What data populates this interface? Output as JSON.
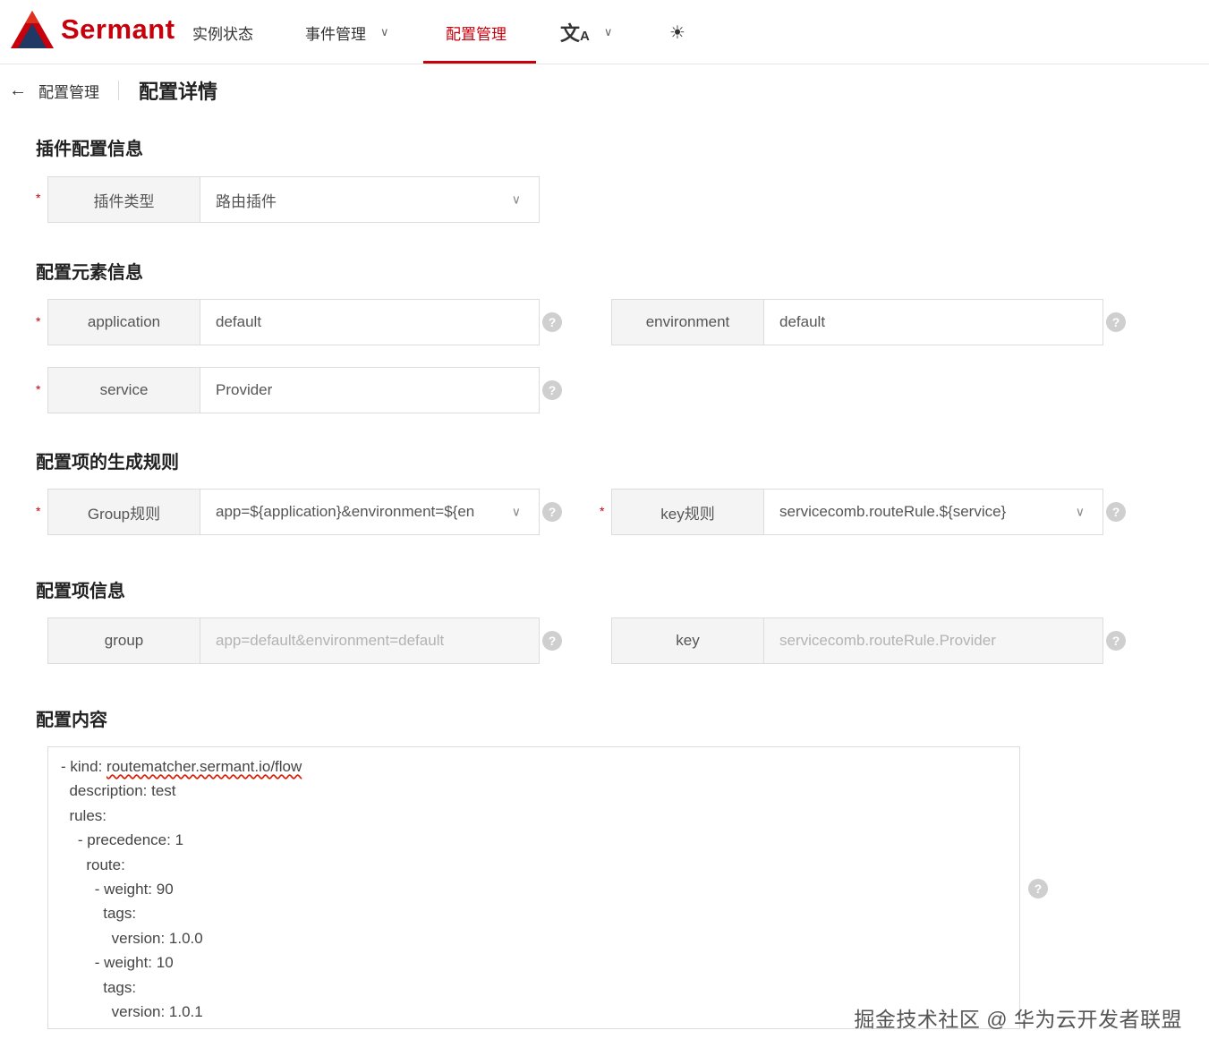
{
  "brand": {
    "name": "Sermant",
    "logo_icon": "sermant-logo-icon",
    "accent": "#c7000b"
  },
  "nav": {
    "instance_status": "实例状态",
    "event_management": "事件管理",
    "config_management": "配置管理"
  },
  "breadcrumb": {
    "parent": "配置管理",
    "current": "配置详情"
  },
  "sections": {
    "plugin_config": "插件配置信息",
    "config_elements": "配置元素信息",
    "generation_rules": "配置项的生成规则",
    "config_item_info": "配置项信息",
    "config_content": "配置内容"
  },
  "fields": {
    "plugin_type": {
      "label": "插件类型",
      "value": "路由插件"
    },
    "application": {
      "label": "application",
      "value": "default"
    },
    "environment": {
      "label": "environment",
      "value": "default"
    },
    "service": {
      "label": "service",
      "value": "Provider"
    },
    "group_rule": {
      "label": "Group规则",
      "value": "app=${application}&environment=${en"
    },
    "key_rule": {
      "label": "key规则",
      "value": "servicecomb.routeRule.${service}"
    },
    "group": {
      "label": "group",
      "value": "app=default&environment=default"
    },
    "key": {
      "label": "key",
      "value": "servicecomb.routeRule.Provider"
    }
  },
  "required_mark": "*",
  "help_glyph": "?",
  "config_content": {
    "lines": [
      {
        "prefix": "- kind: ",
        "underlined": "routematcher.sermant.io/flow"
      },
      {
        "prefix": "  description: test"
      },
      {
        "prefix": "  rules:"
      },
      {
        "prefix": "    - precedence: 1"
      },
      {
        "prefix": "      route:"
      },
      {
        "prefix": "        - weight: 90"
      },
      {
        "prefix": "          tags:"
      },
      {
        "prefix": "            version: 1.0.0"
      },
      {
        "prefix": "        - weight: 10"
      },
      {
        "prefix": "          tags:"
      },
      {
        "prefix": "            version: 1.0.1"
      }
    ]
  },
  "watermark": "掘金技术社区 @ 华为云开发者联盟"
}
